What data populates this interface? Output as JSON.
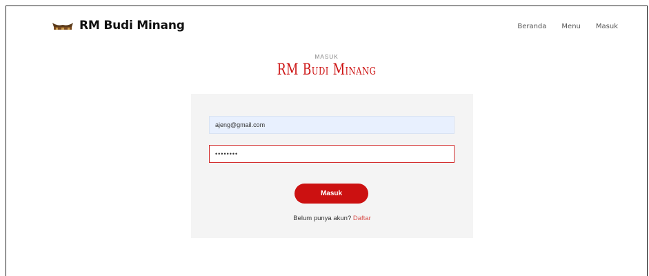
{
  "colors": {
    "accent": "#cc1111",
    "link": "#d9534f",
    "card_bg": "#f4f4f4",
    "autofill_bg": "#e8f0fe"
  },
  "navbar": {
    "logo_icon": "rumah-gadang-roof-icon",
    "brand": "RM Budi Minang",
    "links": [
      {
        "label": "Beranda"
      },
      {
        "label": "Menu"
      },
      {
        "label": "Masuk"
      }
    ]
  },
  "section": {
    "kicker": "MASUK",
    "title": "RM Budi Minang"
  },
  "form": {
    "email_value": "ajeng@gmail.com",
    "password_value": "••••••••",
    "submit_label": "Masuk",
    "register_prompt": "Belum punya akun?",
    "register_link": "Daftar"
  }
}
